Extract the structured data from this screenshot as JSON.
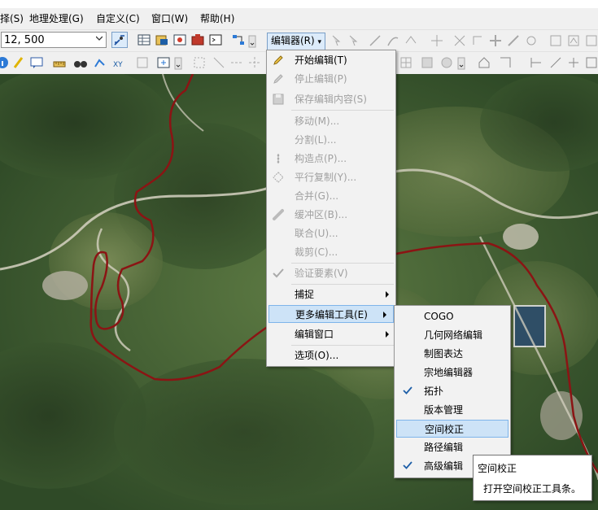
{
  "menubar": {
    "items": [
      "择(S)",
      "地理处理(G)",
      "自定义(C)",
      "窗口(W)",
      "帮助(H)"
    ]
  },
  "toolbar": {
    "scale_value": "12, 500",
    "editor_label": "编辑器(R)"
  },
  "editor_menu": {
    "items": [
      {
        "label": "开始编辑(T)",
        "enabled": true,
        "icon": "pencil-icon"
      },
      {
        "label": "停止编辑(P)",
        "enabled": false,
        "icon": "pencil-stop-icon"
      },
      {
        "label": "保存编辑内容(S)",
        "enabled": false,
        "icon": "save-icon"
      },
      {
        "label": "移动(M)...",
        "enabled": false,
        "icon": ""
      },
      {
        "label": "分割(L)...",
        "enabled": false,
        "icon": ""
      },
      {
        "label": "构造点(P)...",
        "enabled": false,
        "icon": "construct-points-icon"
      },
      {
        "label": "平行复制(Y)...",
        "enabled": false,
        "icon": "copy-parallel-icon"
      },
      {
        "label": "合并(G)...",
        "enabled": false,
        "icon": ""
      },
      {
        "label": "缓冲区(B)...",
        "enabled": false,
        "icon": "buffer-icon"
      },
      {
        "label": "联合(U)...",
        "enabled": false,
        "icon": ""
      },
      {
        "label": "裁剪(C)...",
        "enabled": false,
        "icon": ""
      },
      {
        "label": "验证要素(V)",
        "enabled": false,
        "icon": "validate-icon"
      },
      {
        "label": "捕捉",
        "enabled": true,
        "icon": ""
      },
      {
        "label": "更多编辑工具(E)",
        "enabled": true,
        "icon": ""
      },
      {
        "label": "编辑窗口",
        "enabled": true,
        "icon": ""
      },
      {
        "label": "选项(O)...",
        "enabled": true,
        "icon": ""
      }
    ]
  },
  "submenu": {
    "items": [
      {
        "label": "COGO",
        "checked": false
      },
      {
        "label": "几何网络编辑",
        "checked": false
      },
      {
        "label": "制图表达",
        "checked": false
      },
      {
        "label": "宗地编辑器",
        "checked": false
      },
      {
        "label": "拓扑",
        "checked": true
      },
      {
        "label": "版本管理",
        "checked": false
      },
      {
        "label": "空间校正",
        "checked": false
      },
      {
        "label": "路径编辑",
        "checked": false
      },
      {
        "label": "高级编辑",
        "checked": true
      }
    ]
  },
  "tooltip": {
    "title": "空间校正",
    "description": "打开空间校正工具条。"
  },
  "colors": {
    "route": "#8b1414",
    "highlight": "#cde3f7",
    "check": "#1e5fa8"
  }
}
